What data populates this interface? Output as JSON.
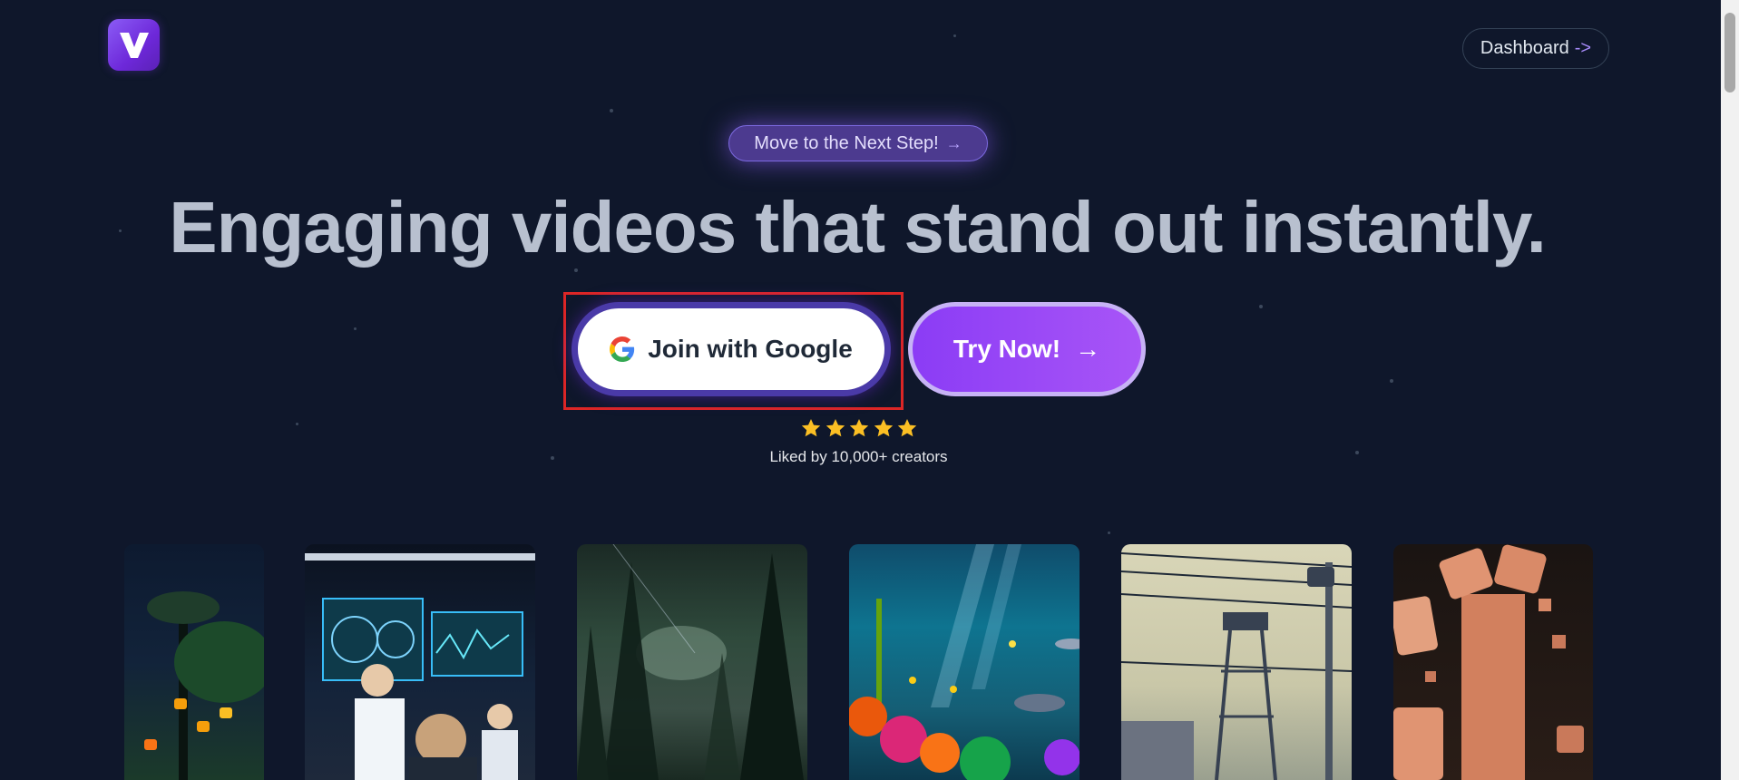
{
  "header": {
    "dashboard_label": "Dashboard",
    "dashboard_arrow": "->"
  },
  "hero": {
    "pill_label": "Move to the Next Step!",
    "pill_arrow": "→",
    "headline": "Engaging videos that stand out instantly.",
    "google_button_label": "Join with Google",
    "try_button_label": "Try Now!",
    "try_button_arrow": "→",
    "rating_stars": 5,
    "social_proof": "Liked by 10,000+ creators"
  },
  "colors": {
    "background": "#0f172b",
    "accent_purple": "#8b3cf5",
    "star_yellow": "#fbbf24",
    "highlight_red": "#dc2626"
  },
  "gallery": {
    "items": [
      {
        "name": "night-palm-lanterns-thumbnail"
      },
      {
        "name": "scientists-lab-thumbnail"
      },
      {
        "name": "misty-forest-light-thumbnail"
      },
      {
        "name": "underwater-reef-thumbnail"
      },
      {
        "name": "watchtower-barbed-wire-thumbnail"
      },
      {
        "name": "crumbling-brick-tower-thumbnail"
      }
    ]
  }
}
